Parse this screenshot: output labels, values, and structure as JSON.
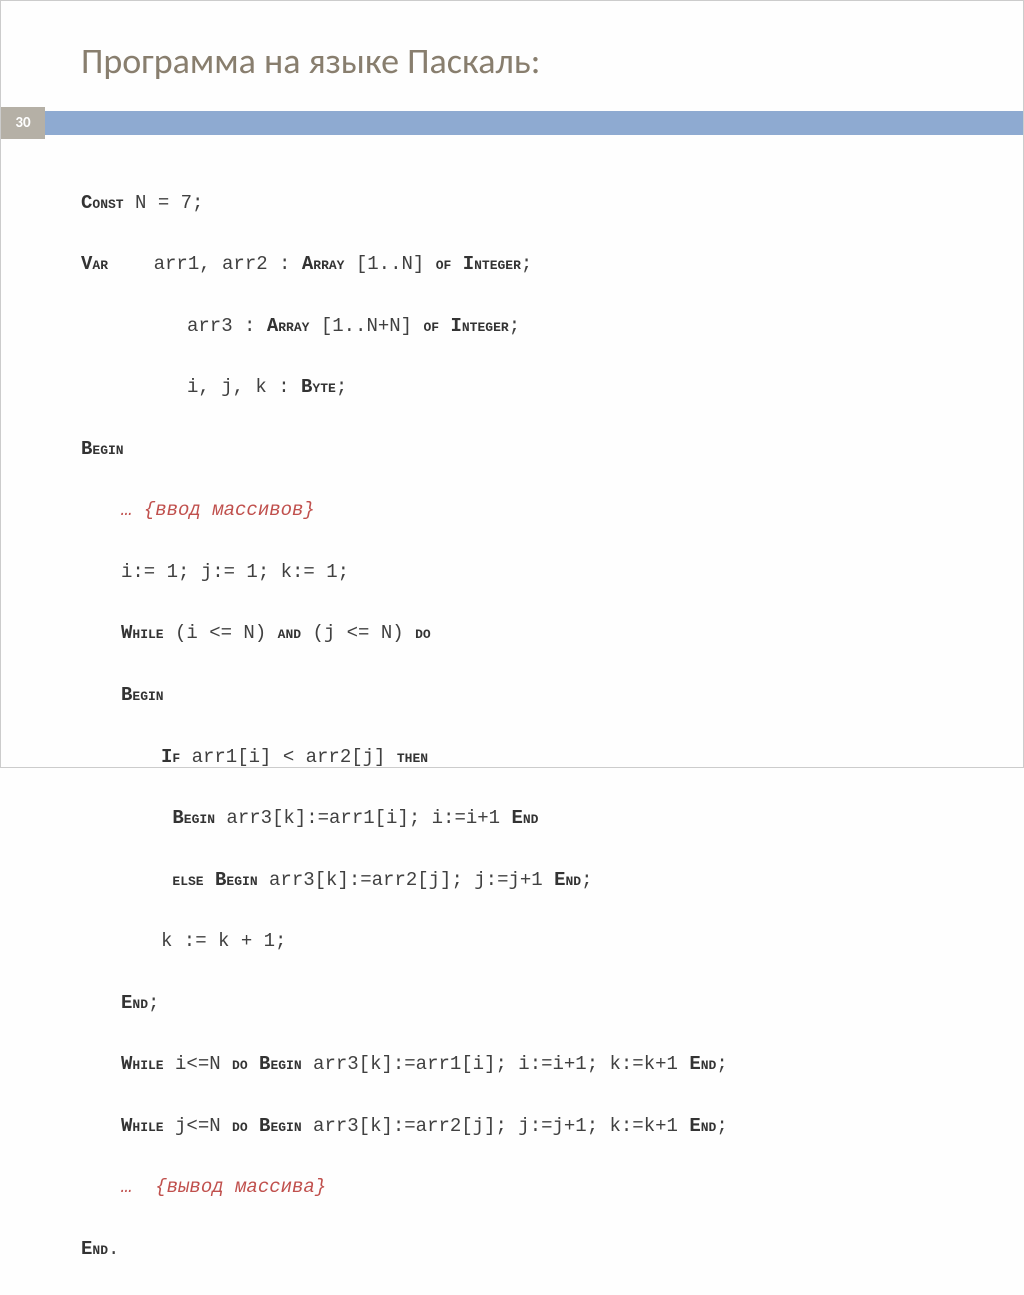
{
  "title": "Программа на языке Паскаль:",
  "page_number": "30",
  "code": {
    "l1a": "Const",
    "l1b": " N = 7;",
    "l2a": "Var",
    "l2b": "    arr1, arr2 : ",
    "l2c": "Array",
    "l2d": " [1..N] ",
    "l2e": "of Integer",
    "l2f": ";",
    "l3a": "arr3 : ",
    "l3b": "Array",
    "l3c": " [1..N+N] ",
    "l3d": "of Integer",
    "l3e": ";",
    "l4a": "i, j, k : ",
    "l4b": "Byte",
    "l4c": ";",
    "l5": "Begin",
    "l6": "… {ввод массивов}",
    "l7": "i:= 1; j:= 1; k:= 1;",
    "l8a": "While",
    "l8b": " (i <= N) ",
    "l8c": "and",
    "l8d": " (j <= N) ",
    "l8e": "do",
    "l9": "Begin",
    "l10a": "If",
    "l10b": " arr1[i] < arr2[j] ",
    "l10c": "then",
    "l11a": "Begin",
    "l11b": " arr3[k]:=arr1[i]; i:=i+1 ",
    "l11c": "End",
    "l12a": "else Begin",
    "l12b": " arr3[k]:=arr2[j]; j:=j+1 ",
    "l12c": "End",
    "l12d": ";",
    "l13": "k := k + 1;",
    "l14a": "End",
    "l14b": ";",
    "l15a": "While",
    "l15b": " i<=N ",
    "l15c": "do Begin",
    "l15d": " arr3[k]:=arr1[i]; i:=i+1; k:=k+1 ",
    "l15e": "End",
    "l15f": ";",
    "l16a": "While",
    "l16b": " j<=N ",
    "l16c": "do Begin",
    "l16d": " arr3[k]:=arr2[j]; j:=j+1; k:=k+1 ",
    "l16e": "End",
    "l16f": ";",
    "l17": "…  {вывод массива}",
    "l18a": "End",
    "l18b": "."
  }
}
